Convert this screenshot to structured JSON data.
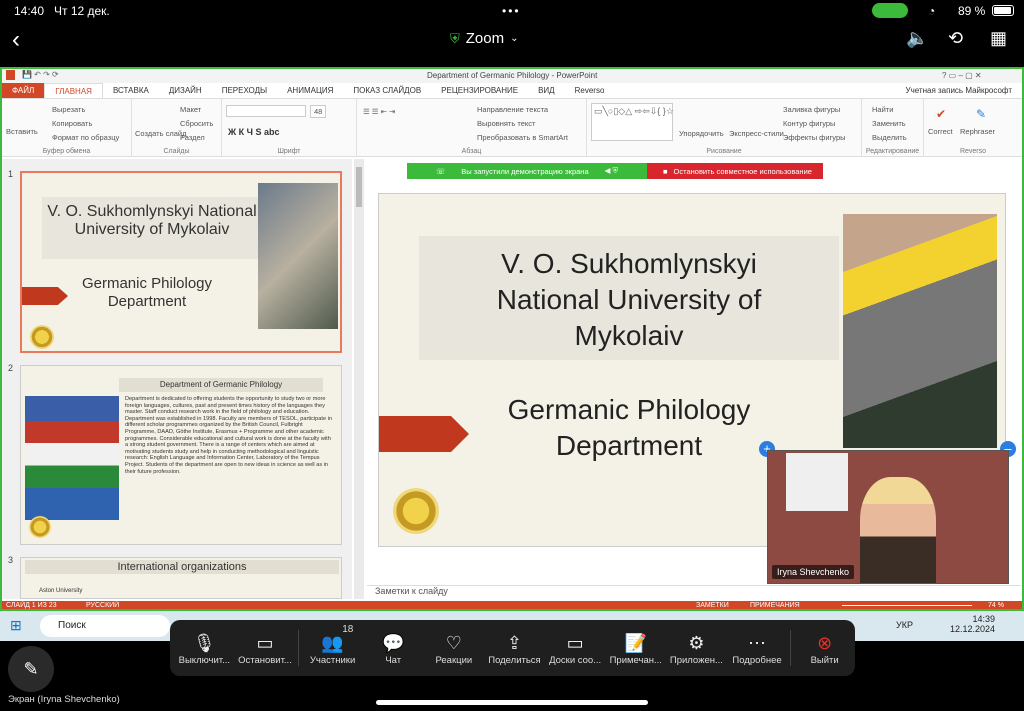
{
  "status_bar": {
    "time": "14:40",
    "date": "Чт 12 дек.",
    "battery": "89 %"
  },
  "zoom_header": {
    "title": "Zoom"
  },
  "ppt": {
    "window_title": "Department of Germanic Philology - PowerPoint",
    "account": "Учетная запись Майкрософт",
    "tabs": [
      "ФАЙЛ",
      "ГЛАВНАЯ",
      "ВСТАВКА",
      "ДИЗАЙН",
      "ПЕРЕХОДЫ",
      "АНИМАЦИЯ",
      "ПОКАЗ СЛАЙДОВ",
      "РЕЦЕНЗИРОВАНИЕ",
      "ВИД",
      "Reverso"
    ],
    "ribbon": {
      "paste": "Вставить",
      "cut": "Вырезать",
      "copy": "Копировать",
      "format_painter": "Формат по образцу",
      "clipboard": "Буфер обмена",
      "new_slide": "Создать слайд",
      "layout": "Макет",
      "reset": "Сбросить",
      "section": "Раздел",
      "slides": "Слайды",
      "font": "Шрифт",
      "font_size": "48",
      "text_direction": "Направление текста",
      "align_text": "Выровнять текст",
      "smartart": "Преобразовать в SmartArt",
      "paragraph": "Абзац",
      "arrange": "Упорядочить",
      "quick_styles": "Экспресс-стили",
      "shape_fill": "Заливка фигуры",
      "shape_outline": "Контур фигуры",
      "shape_effects": "Эффекты фигуры",
      "drawing": "Рисование",
      "find": "Найти",
      "replace": "Заменить",
      "select": "Выделить",
      "editing": "Редактирование",
      "correct": "Correct",
      "rephraser": "Rephraser",
      "reverso": "Reverso"
    },
    "share_bar": {
      "started": "Вы запустили демонстрацию экрана",
      "stop": "Остановить совместное использование"
    },
    "thumbs": [
      {
        "num": "1",
        "title": "V. O. Sukhomlynskyi National University of Mykolaiv",
        "sub": "Germanic Philology Department"
      },
      {
        "num": "2",
        "title": "Department of Germanic Philology",
        "body": "Department is dedicated to offering students the opportunity to study two or more foreign languages, cultures, past and present times history of the languages they master. Staff conduct research work in the field of philology and education. Department was established in 1998. Faculty are members of TESOL, participate in different scholar programmes organized by the British Council, Fulbright Programme, DAAD, Göthe Institute, Erasmus + Programme and other academic programmes. Considerable educational and cultural work is done at the faculty with a strong student government. There is a range of centers which are aimed at motivating students study and help in conducting methodological and linguistic research: English Language and Information Center, Laboratory of the Tempus Project. Students of the department are open to new ideas in science as well as in their future profession."
      },
      {
        "num": "3",
        "title": "International organizations",
        "sub": "Aston University"
      }
    ],
    "main_slide": {
      "title_l1": "V. O. Sukhomlynskyi",
      "title_l2": "National University of",
      "title_l3": "Mykolaiv",
      "sub_l1": "Germanic Philology",
      "sub_l2": "Department"
    },
    "notes": "Заметки к слайду",
    "status": {
      "slide": "СЛАЙД 1 ИЗ 23",
      "lang": "РУССКИЙ",
      "notes": "ЗАМЕТКИ",
      "comments": "ПРИМЕЧАНИЯ",
      "zoom": "74 %"
    }
  },
  "taskbar": {
    "search": "Поиск",
    "lang": "УКР",
    "time": "14:39",
    "date": "12.12.2024"
  },
  "video": {
    "name": "Iryna Shevchenko"
  },
  "toolbar": {
    "mute": "Выключит...",
    "stop_video": "Остановит...",
    "participants": "Участники",
    "participants_count": "18",
    "chat": "Чат",
    "reactions": "Реакции",
    "share": "Поделиться",
    "whiteboards": "Доски соо...",
    "notes": "Примечан...",
    "apps": "Приложен...",
    "more": "Подробнее",
    "leave": "Выйти"
  },
  "screen_label": "Экран (Iryna Shevchenko)"
}
